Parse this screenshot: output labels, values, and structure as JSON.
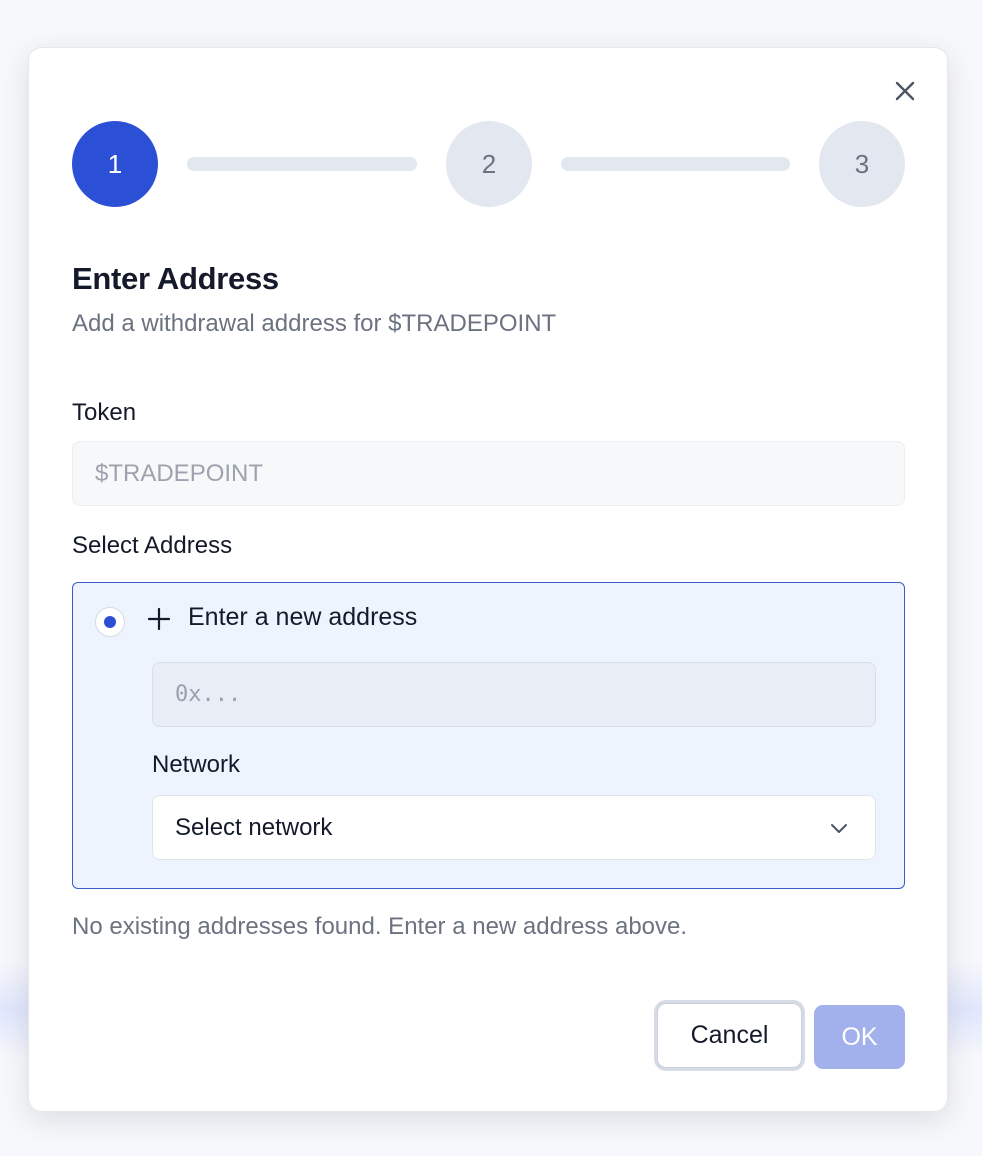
{
  "modal": {
    "title": "Enter Address",
    "subtitle": "Add a withdrawal address for $TRADEPOINT",
    "close_icon": "close-icon"
  },
  "stepper": {
    "steps": [
      {
        "label": "1",
        "state": "active"
      },
      {
        "label": "2",
        "state": "inactive"
      },
      {
        "label": "3",
        "state": "inactive"
      }
    ],
    "active_color": "#2b4fd5",
    "inactive_color": "#e3e7ef"
  },
  "token": {
    "label": "Token",
    "value": "$TRADEPOINT"
  },
  "select_address": {
    "label": "Select Address",
    "new_address": {
      "label": "Enter a new address",
      "selected": true,
      "icon": "plus-icon",
      "input_placeholder": "0x...",
      "input_value": "",
      "network_label": "Network",
      "network_value": "Select network",
      "network_icon": "chevron-down-icon"
    },
    "helper_text": "No existing addresses found. Enter a new address above."
  },
  "footer": {
    "cancel_label": "Cancel",
    "ok_label": "OK",
    "ok_color": "#a2b1ec"
  }
}
